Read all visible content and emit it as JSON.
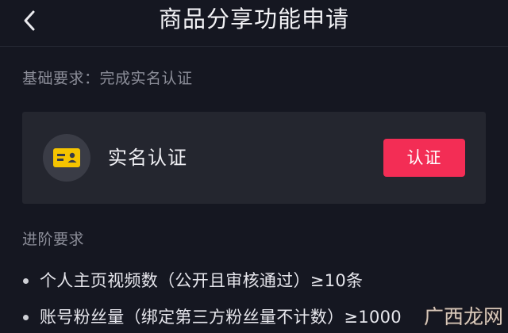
{
  "header": {
    "title": "商品分享功能申请",
    "back_icon": "chevron-left-icon"
  },
  "basic": {
    "label": "基础要求：完成实名认证"
  },
  "verify_card": {
    "icon": "id-card-icon",
    "label": "实名认证",
    "button_label": "认证",
    "button_color": "#f32d55",
    "icon_color": "#f5c400"
  },
  "advanced": {
    "label": "进阶要求",
    "items": [
      {
        "text": "个人主页视频数（公开且审核通过）≥10条"
      },
      {
        "text": "账号粉丝量（绑定第三方粉丝量不计数）≥1000"
      }
    ]
  },
  "watermark": {
    "text": "广西龙网"
  },
  "colors": {
    "background": "#151721",
    "card": "#24262f",
    "muted_text": "#8c8e99",
    "accent": "#f32d55"
  }
}
